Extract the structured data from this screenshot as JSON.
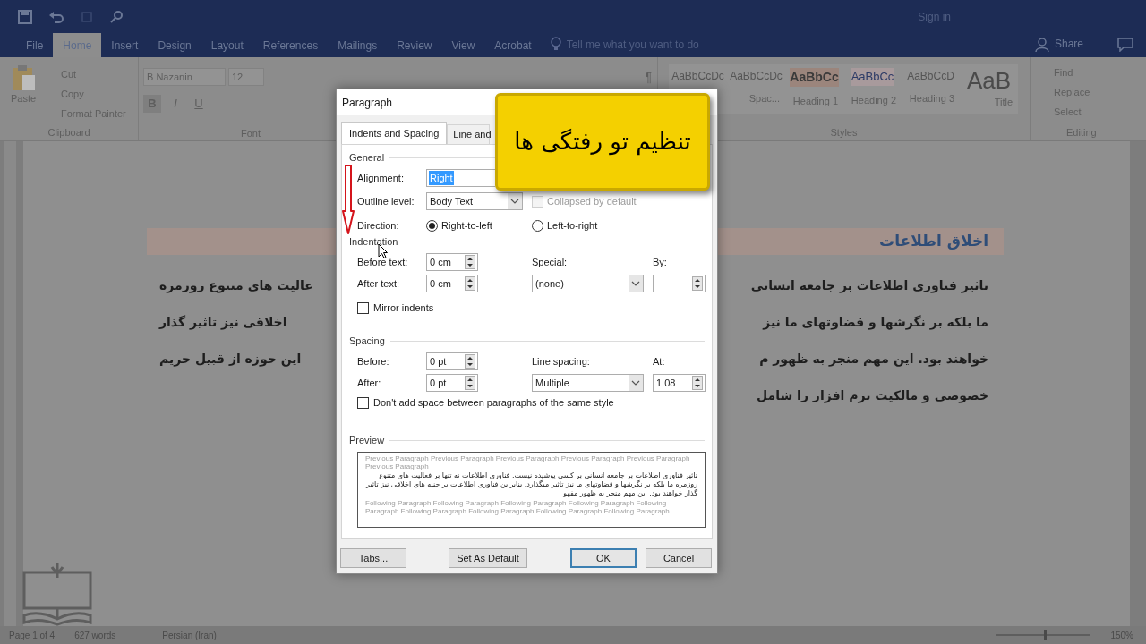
{
  "title_bar": {
    "sign_in": "Sign in"
  },
  "ribbon_tabs": [
    {
      "label": "File",
      "selected": false
    },
    {
      "label": "Home",
      "selected": true
    },
    {
      "label": "Insert",
      "selected": false
    },
    {
      "label": "Design",
      "selected": false
    },
    {
      "label": "Layout",
      "selected": false
    },
    {
      "label": "References",
      "selected": false
    },
    {
      "label": "Mailings",
      "selected": false
    },
    {
      "label": "Review",
      "selected": false
    },
    {
      "label": "View",
      "selected": false
    },
    {
      "label": "Acrobat",
      "selected": false
    }
  ],
  "tell_me": {
    "placeholder": "Tell me what you want to do"
  },
  "share": "Share",
  "ribbon": {
    "clipboard": {
      "paste": "Paste",
      "items": [
        "Cut",
        "Copy",
        "Format Painter"
      ],
      "group": "Clipboard"
    },
    "font": {
      "name": "B Nazanin",
      "size": "12",
      "format_buttons": [
        "B",
        "I",
        "U"
      ],
      "group": "Font"
    },
    "paragraph": {
      "mark": "¶"
    },
    "styles": {
      "items": [
        {
          "sample": "AaBbCcDc"
        },
        {
          "sample": "AaBbCcDc",
          "label": "Spac..."
        },
        {
          "sample": "AaBbCc",
          "label": "Heading 1"
        },
        {
          "sample": "AaBbCc",
          "label": "Heading 2"
        },
        {
          "sample": "AaBbCcD",
          "label": "Heading 3"
        },
        {
          "sample": "AaB",
          "label": "Title"
        }
      ],
      "group": "Styles"
    },
    "editing": {
      "items": [
        "Find",
        "Replace",
        "Select"
      ],
      "group": "Editing"
    }
  },
  "document": {
    "heading": "اخلاق اطلاعات",
    "lines": [
      {
        "right": "تاثیر فناوری اطلاعات بر جامعه انسانی",
        "left": "عالیت های متنوع روزمره"
      },
      {
        "right": "ما بلکه  بر نگرشها و قضاوتهای ما نیز",
        "left": "اخلاقی نیز تاثیر گذار"
      },
      {
        "right": "خواهند بود. این مهم منجر به ظهور م",
        "left": "این حوزه از قبیل حریم"
      },
      {
        "right": "خصوصی و مالکیت نرم افزار را شامل"
      }
    ]
  },
  "dialog": {
    "title": "Paragraph",
    "tabs": [
      {
        "label": "Indents and Spacing",
        "selected": true
      },
      {
        "label": "Line and",
        "selected": false
      }
    ],
    "general": {
      "heading": "General",
      "alignment_label": "Alignment:",
      "alignment": "Right",
      "outline_label": "Outline level:",
      "outline": "Body Text",
      "collapsed": {
        "label": "Collapsed by default",
        "checked": false,
        "disabled": true
      },
      "direction_label": "Direction:",
      "directions": [
        {
          "label": "Right-to-left",
          "selected": true
        },
        {
          "label": "Left-to-right",
          "selected": false
        }
      ]
    },
    "indentation": {
      "heading": "Indentation",
      "before_label": "Before text:",
      "before": "0 cm",
      "after_label": "After text:",
      "after": "0 cm",
      "special_label": "Special:",
      "special": "(none)",
      "by_label": "By:",
      "mirror": {
        "label": "Mirror indents",
        "checked": false
      }
    },
    "spacing": {
      "heading": "Spacing",
      "before_label": "Before:",
      "before": "0 pt",
      "after_label": "After:",
      "after": "0 pt",
      "line_label": "Line spacing:",
      "line": "Multiple",
      "at_label": "At:",
      "at": "1.08",
      "no_space": {
        "label": "Don't add space between paragraphs of the same style",
        "checked": false
      }
    },
    "preview": {
      "heading": "Preview",
      "previous": "Previous Paragraph Previous Paragraph Previous Paragraph Previous Paragraph Previous Paragraph Previous Paragraph",
      "sample": "تاثیر فناوری اطلاعات بر جامعه انسانی بر کسی پوشیده نیست. فناوری اطلاعات نه تنها بر فعالیت های متنوع روزمره ما بلکه  بر نگرشها و قضاوتهای ما نیز تاثیر میگذارد. بنابراین فناوری اطلاعات بر جنبه های اخلاقی نیز تاثیر گذار خواهند بود. این مهم منجر به ظهور مفهو",
      "following": "Following Paragraph Following Paragraph Following Paragraph Following Paragraph Following Paragraph Following Paragraph Following Paragraph Following Paragraph Following Paragraph"
    },
    "buttons": [
      {
        "label": "Tabs...",
        "kind": "normal"
      },
      {
        "label": "Set As Default",
        "kind": "normal"
      },
      {
        "label": "OK",
        "kind": "default"
      },
      {
        "label": "Cancel",
        "kind": "normal"
      }
    ]
  },
  "callout": "تنظیم تو رفتگی ها",
  "status_bar": {
    "page": "Page 1 of 4",
    "words": "627 words",
    "language": "Persian (Iran)",
    "zoom_slider": {
      "level": 0.52
    },
    "zoom": "150%"
  }
}
